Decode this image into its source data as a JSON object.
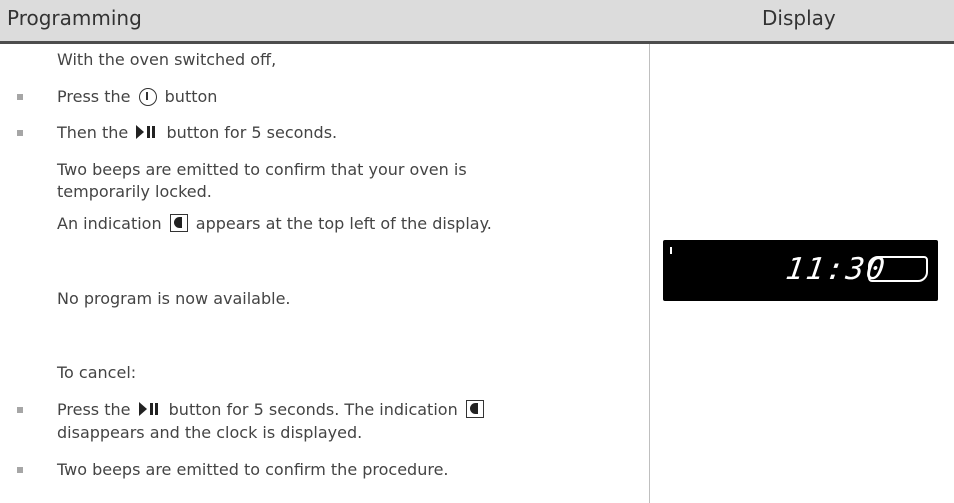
{
  "header": {
    "left_title": "Programming",
    "right_title": "Display"
  },
  "content": {
    "intro": "With the oven switched off,",
    "step1_prefix": "Press the",
    "step1_suffix": "button",
    "step2_prefix": "Then the",
    "step2_suffix": "button for 5 seconds.",
    "beeps_line1": "Two beeps are emitted to confirm that your oven is",
    "beeps_line2": "temporarily locked.",
    "indication_prefix": "An indication",
    "indication_suffix": "appears at the top left of the display.",
    "no_program": "No program is now available.",
    "to_cancel": "To cancel:",
    "cancel1_prefix": "Press the",
    "cancel1_middle": "button for 5 seconds. The indication",
    "cancel1_line2": "disappears and the clock is displayed.",
    "cancel2": "Two beeps are emitted to confirm the procedure."
  },
  "display": {
    "time": "11:30"
  },
  "icons": {
    "power": "power-icon",
    "play_pause": "play-pause-icon",
    "lock_indicator": "lock-indicator-icon"
  }
}
